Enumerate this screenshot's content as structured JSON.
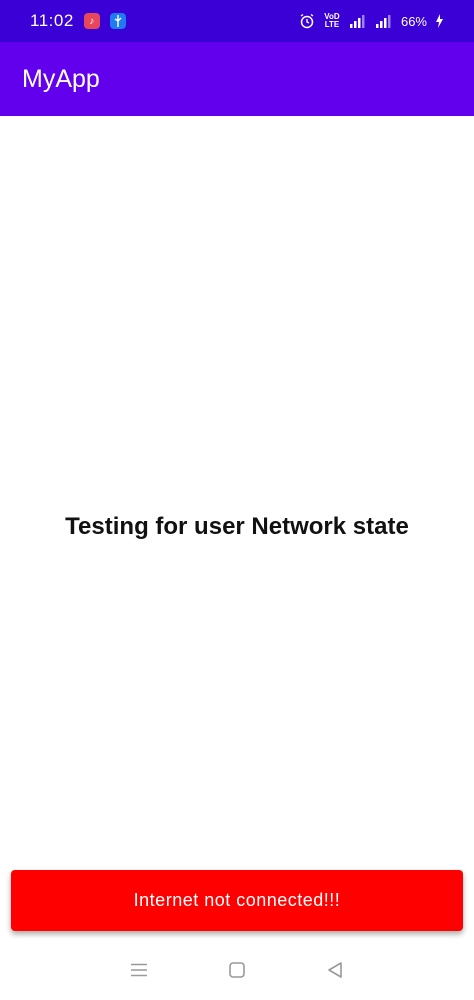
{
  "status_bar": {
    "time": "11:02",
    "volte_line1": "VoD",
    "volte_line2": "LTE",
    "battery": "66%",
    "icons": [
      "music-icon",
      "usb-icon",
      "alarm-icon",
      "volte-icon",
      "signal-icon",
      "signal-icon",
      "charging-icon"
    ]
  },
  "app_bar": {
    "title": "MyApp",
    "color": "#6200ee"
  },
  "main": {
    "message": "Testing for user Network state"
  },
  "snackbar": {
    "text": "Internet not connected!!!",
    "color": "#ff0000"
  },
  "nav_bar": {
    "buttons": [
      "menu-icon",
      "home-icon",
      "back-icon"
    ]
  }
}
